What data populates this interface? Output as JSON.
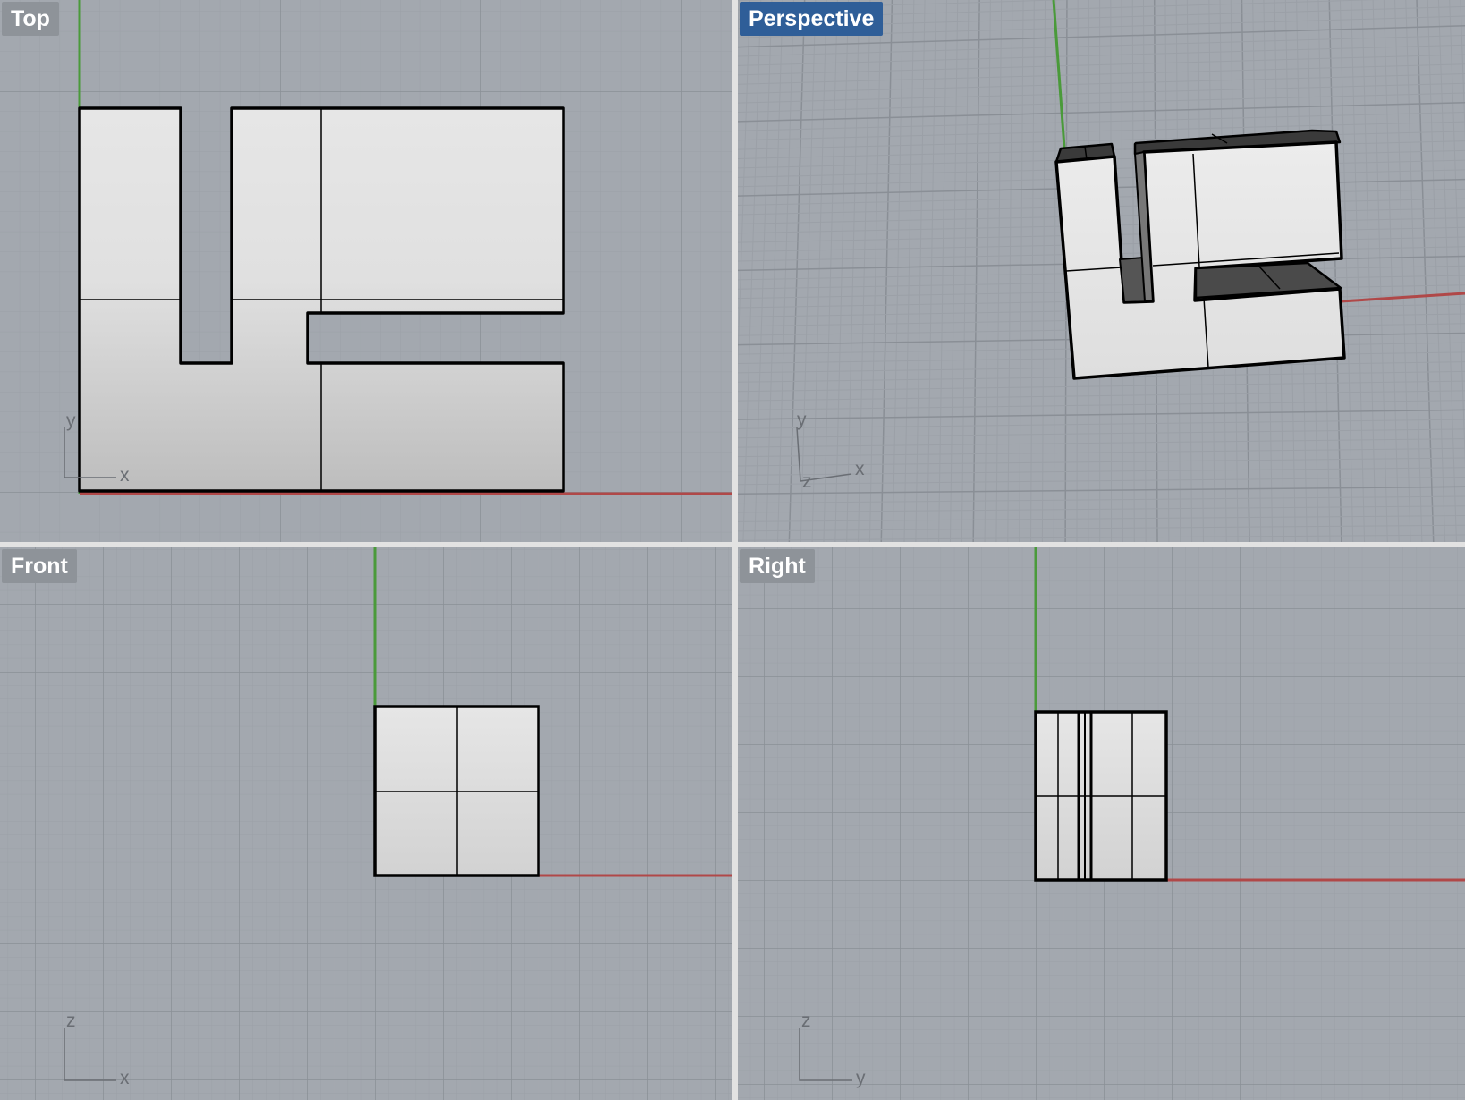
{
  "viewports": [
    {
      "id": "top",
      "label": "Top",
      "active": false,
      "axes": [
        "x",
        "y"
      ]
    },
    {
      "id": "perspective",
      "label": "Perspective",
      "active": true,
      "axes": [
        "x",
        "y",
        "z"
      ]
    },
    {
      "id": "front",
      "label": "Front",
      "active": false,
      "axes": [
        "x",
        "z"
      ]
    },
    {
      "id": "right",
      "label": "Right",
      "active": false,
      "axes": [
        "y",
        "z"
      ]
    }
  ],
  "colors": {
    "background": "#a3a8af",
    "grid_minor": "#9ba0a7",
    "grid_major": "#8a8f96",
    "x_axis": "#b04848",
    "y_axis": "#4a9a3a",
    "active_label": "#2f5e98",
    "inactive_label": "#8e9399",
    "model_fill_light": "#e4e4e4",
    "model_fill_dark": "#bcbcbc",
    "model_edge": "#000000"
  }
}
